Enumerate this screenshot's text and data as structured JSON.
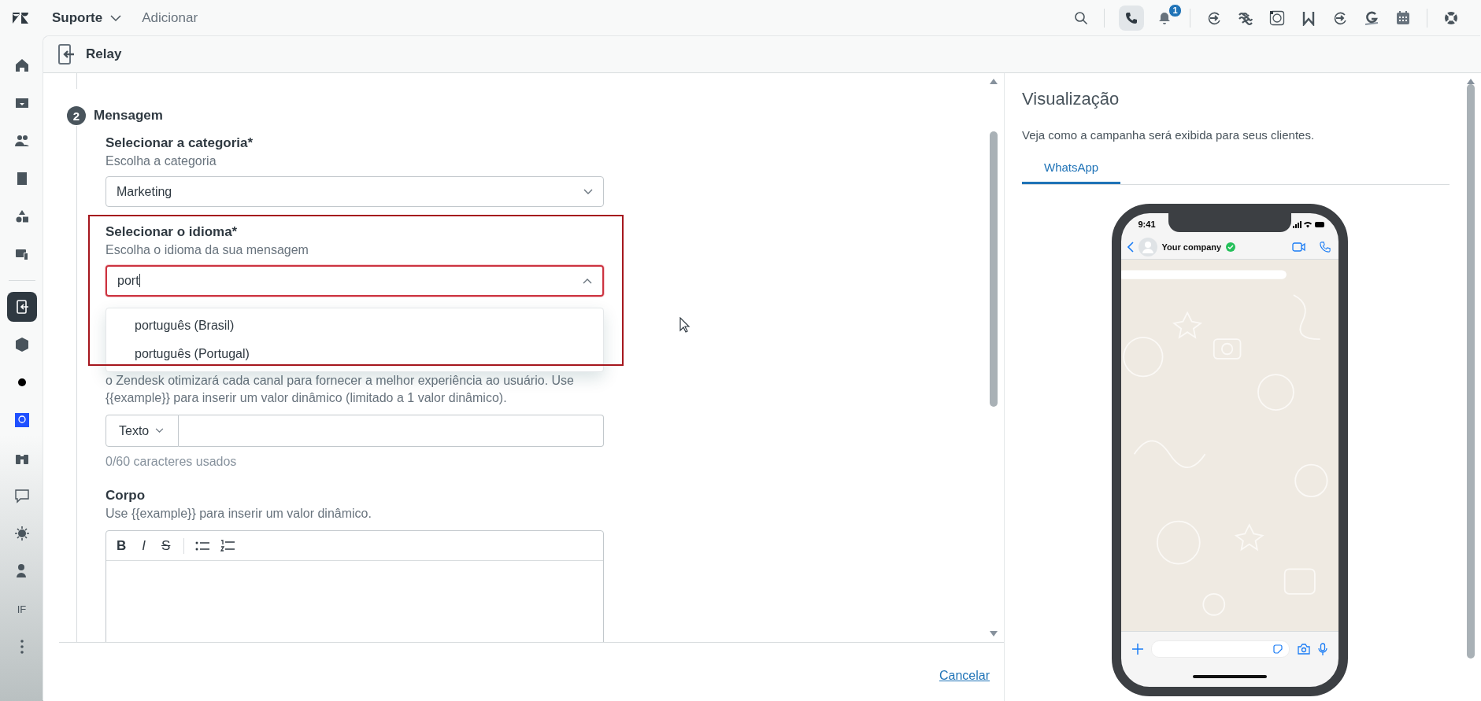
{
  "top_bar": {
    "product": "Suporte",
    "add": "Adicionar",
    "notification_count": "1"
  },
  "nav_items": [
    {
      "selected": false
    },
    {
      "selected": false
    },
    {
      "selected": false
    },
    {
      "selected": false
    },
    {
      "selected": false
    },
    {
      "selected": false
    },
    {
      "selected": true
    },
    {
      "selected": false
    },
    {
      "selected": false
    },
    {
      "selected": false
    },
    {
      "selected": false
    },
    {
      "selected": false
    },
    {
      "selected": false
    },
    {
      "selected": false
    },
    {
      "label": "IF",
      "selected": false
    },
    {
      "selected": false
    }
  ],
  "page_header": {
    "title": "Relay"
  },
  "form": {
    "step_number": "2",
    "step_title": "Mensagem",
    "category": {
      "label": "Selecionar a categoria*",
      "hint": "Escolha a categoria",
      "value": "Marketing"
    },
    "language": {
      "label": "Selecionar o idioma*",
      "hint": "Escolha o idioma da sua mensagem",
      "value": "port",
      "expanded": true,
      "highlighted": true,
      "options": [
        {
          "label": "português (Brasil)"
        },
        {
          "label": "português (Portugal)"
        }
      ]
    },
    "header_help": [
      "o Zendesk otimizará cada canal para fornecer a melhor experiência ao usuário. Use",
      "{{example}} para inserir um valor dinâmico (limitado a 1 valor dinâmico)."
    ],
    "header_type": "Texto",
    "counter": "0/60 caracteres usados",
    "body": {
      "label": "Corpo",
      "hint": "Use {{example}} para inserir um valor dinâmico.",
      "format_buttons": [
        "B",
        "I",
        "S"
      ]
    }
  },
  "cancel": "Cancelar",
  "preview": {
    "title": "Visualização",
    "description": "Veja como a campanha será exibida para seus clientes.",
    "tabs": [
      {
        "label": "WhatsApp",
        "selected": true
      }
    ],
    "phone": {
      "time": "9:41",
      "contact": "Your company",
      "verified": true
    }
  }
}
